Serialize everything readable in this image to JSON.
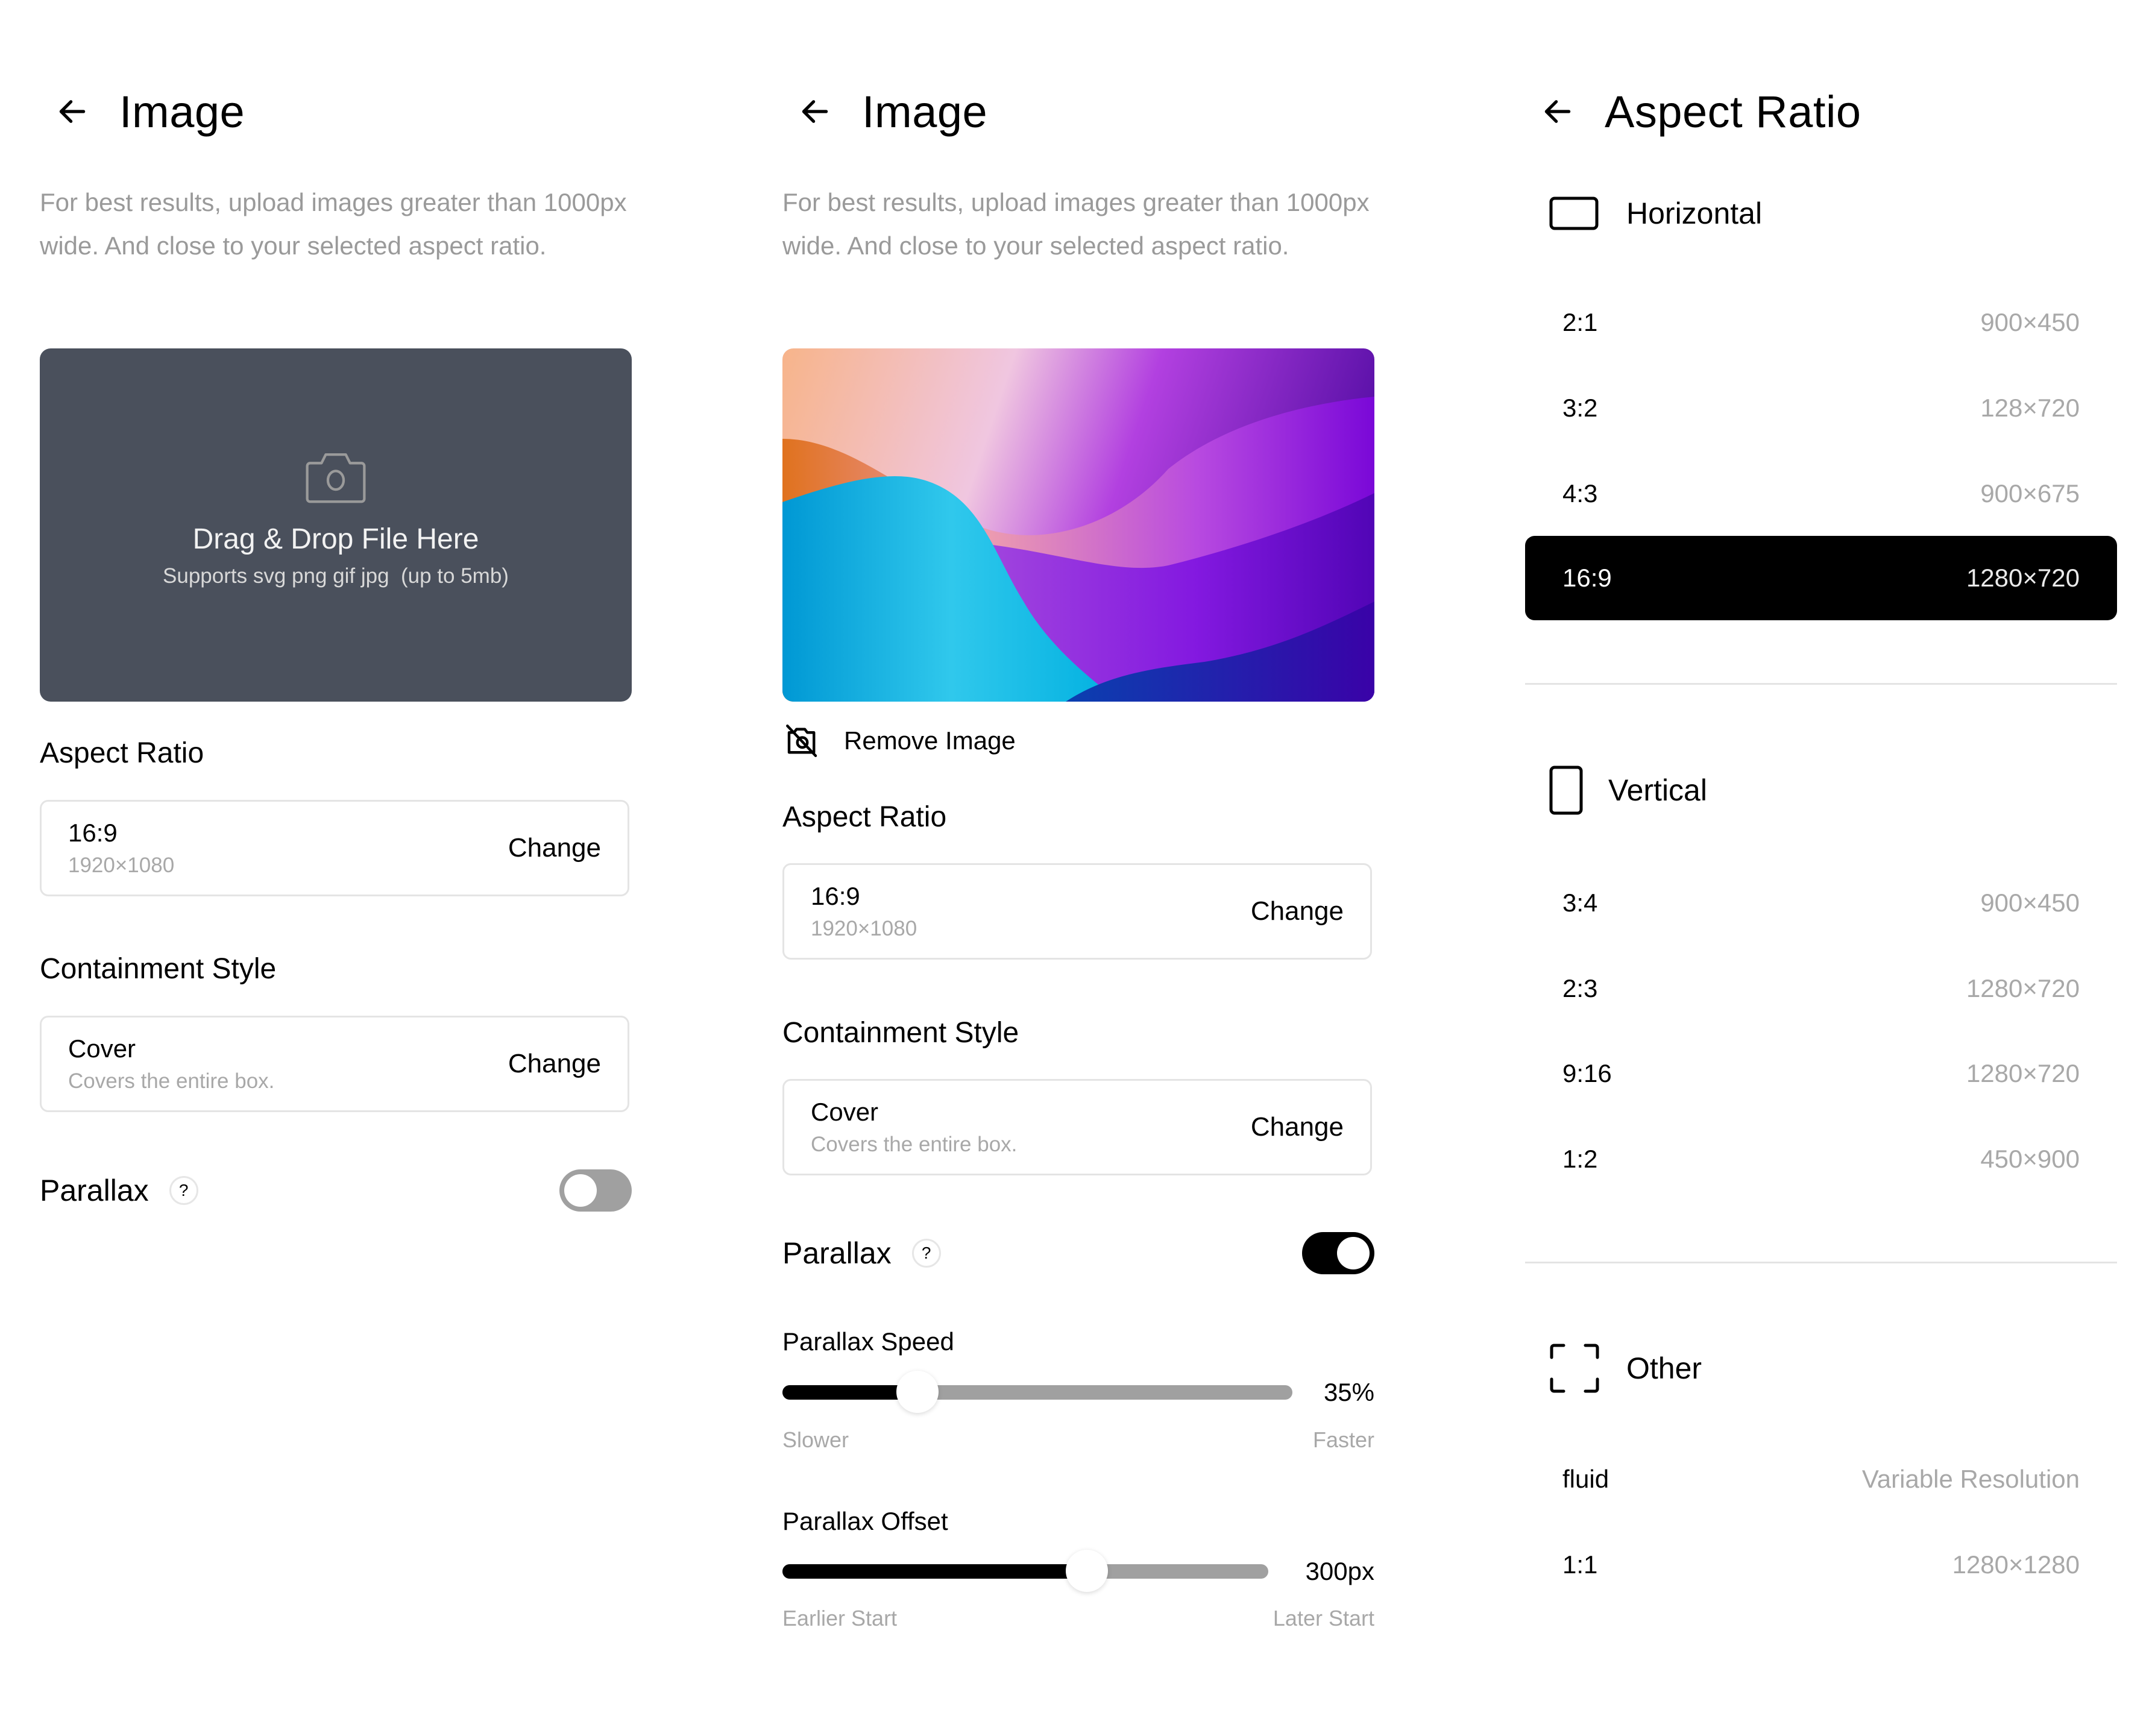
{
  "panel_upload": {
    "title": "Image",
    "hint": "For best results, upload images greater than 1000px wide. And close to your selected aspect ratio.",
    "dropzone": {
      "title": "Drag & Drop File Here",
      "subtitle": "Supports svg png gif jpg  (up to 5mb)"
    },
    "aspect_ratio": {
      "heading": "Aspect Ratio",
      "value": "16:9",
      "resolution": "1920×1080",
      "action": "Change"
    },
    "containment": {
      "heading": "Containment Style",
      "value": "Cover",
      "description": "Covers the entire box.",
      "action": "Change"
    },
    "parallax": {
      "label": "Parallax",
      "help": "?",
      "enabled": false
    }
  },
  "panel_image": {
    "title": "Image",
    "hint": "For best results, upload images greater than 1000px wide. And close to your selected aspect ratio.",
    "remove_label": "Remove Image",
    "aspect_ratio": {
      "heading": "Aspect Ratio",
      "value": "16:9",
      "resolution": "1920×1080",
      "action": "Change"
    },
    "containment": {
      "heading": "Containment Style",
      "value": "Cover",
      "description": "Covers the entire box.",
      "action": "Change"
    },
    "parallax": {
      "label": "Parallax",
      "help": "?",
      "enabled": true
    },
    "speed": {
      "label": "Parallax Speed",
      "value_text": "35%",
      "fraction": 0.265,
      "min_label": "Slower",
      "max_label": "Faster"
    },
    "offset": {
      "label": "Parallax Offset",
      "value_text": "300px",
      "fraction": 0.627,
      "min_label": "Earlier Start",
      "max_label": "Later Start"
    }
  },
  "panel_aspect": {
    "title": "Aspect Ratio",
    "groups": [
      {
        "name": "Horizontal",
        "icon": "landscape-rect-icon",
        "options": [
          {
            "ratio": "2:1",
            "size": "900×450"
          },
          {
            "ratio": "3:2",
            "size": "128×720"
          },
          {
            "ratio": "4:3",
            "size": "900×675"
          },
          {
            "ratio": "16:9",
            "size": "1280×720",
            "selected": true
          }
        ]
      },
      {
        "name": "Vertical",
        "icon": "portrait-rect-icon",
        "options": [
          {
            "ratio": "3:4",
            "size": "900×450"
          },
          {
            "ratio": "2:3",
            "size": "1280×720"
          },
          {
            "ratio": "9:16",
            "size": "1280×720"
          },
          {
            "ratio": "1:2",
            "size": "450×900"
          }
        ]
      },
      {
        "name": "Other",
        "icon": "frame-corners-icon",
        "options": [
          {
            "ratio": "fluid",
            "size": "Variable Resolution"
          },
          {
            "ratio": "1:1",
            "size": "1280×1280"
          }
        ]
      }
    ]
  },
  "colors": {
    "dropzone_bg": "#4a505c",
    "muted_text": "#9a9a9a",
    "toggle_off": "#a0a0a0",
    "accent": "#000000"
  }
}
